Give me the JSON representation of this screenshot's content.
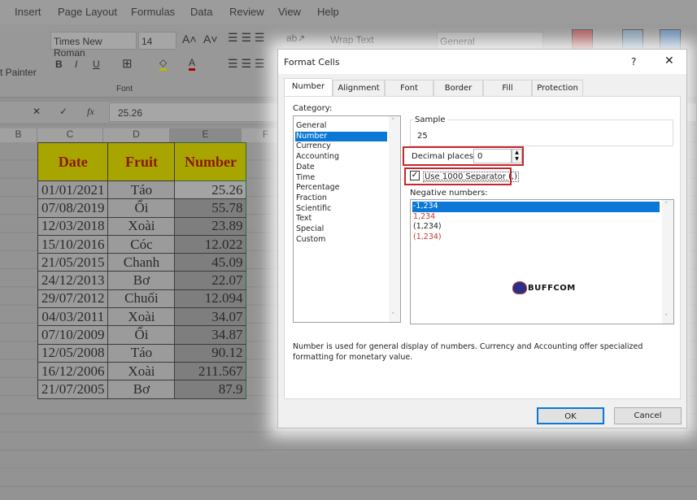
{
  "menu": [
    "Insert",
    "Page Layout",
    "Formulas",
    "Data",
    "Review",
    "View",
    "Help"
  ],
  "ribbon": {
    "font_name": "Times New Roman",
    "font_size": "14",
    "format_painter": "t Painter",
    "font_group": "Font",
    "wrap_text": "Wrap Text",
    "number_format": "General",
    "bold": "B",
    "italic": "I",
    "underline": "U"
  },
  "formula_bar": {
    "value": "25.26",
    "fx": "fx",
    "cancel": "✕",
    "enter": "✓"
  },
  "columns": [
    "B",
    "C",
    "D",
    "E",
    "F"
  ],
  "sheet": {
    "headers": [
      "Date",
      "Fruit",
      "Number"
    ],
    "rows": [
      [
        "01/01/2021",
        "Táo",
        "25.26"
      ],
      [
        "07/08/2019",
        "Ổi",
        "55.78"
      ],
      [
        "12/03/2018",
        "Xoài",
        "23.89"
      ],
      [
        "15/10/2016",
        "Cóc",
        "12.022"
      ],
      [
        "21/05/2015",
        "Chanh",
        "45.09"
      ],
      [
        "24/12/2013",
        "Bơ",
        "22.07"
      ],
      [
        "29/07/2012",
        "Chuối",
        "12.094"
      ],
      [
        "04/03/2011",
        "Xoài",
        "34.07"
      ],
      [
        "07/10/2009",
        "Ổi",
        "34.87"
      ],
      [
        "12/05/2008",
        "Táo",
        "90.12"
      ],
      [
        "16/12/2006",
        "Xoài",
        "211.567"
      ],
      [
        "21/07/2005",
        "Bơ",
        "87.9"
      ]
    ]
  },
  "dialog": {
    "title": "Format Cells",
    "help": "?",
    "close": "✕",
    "tabs": [
      "Number",
      "Alignment",
      "Font",
      "Border",
      "Fill",
      "Protection"
    ],
    "category_label": "Category:",
    "categories": [
      "General",
      "Number",
      "Currency",
      "Accounting",
      "Date",
      "Time",
      "Percentage",
      "Fraction",
      "Scientific",
      "Text",
      "Special",
      "Custom"
    ],
    "selected_category": "Number",
    "sample_label": "Sample",
    "sample_value": "25",
    "decimal_label": "Decimal places:",
    "decimal_value": "0",
    "separator_label": "Use 1000 Separator (,)",
    "separator_checked": true,
    "negative_label": "Negative numbers:",
    "negative_options": [
      "-1,234",
      "1,234",
      "(1,234)",
      "(1,234)"
    ],
    "negative_colors": [
      "#ffffff",
      "#c0392b",
      "#222222",
      "#c0392b"
    ],
    "description": "Number is used for general display of numbers.  Currency and Accounting offer specialized formatting for monetary value.",
    "ok": "OK",
    "cancel": "Cancel",
    "watermark": "BUFFCOM"
  },
  "colors": {
    "highlight": "#c8262c",
    "selection": "#0b78d7",
    "header_fill": "#a8a400",
    "header_text": "#8a1a00"
  }
}
